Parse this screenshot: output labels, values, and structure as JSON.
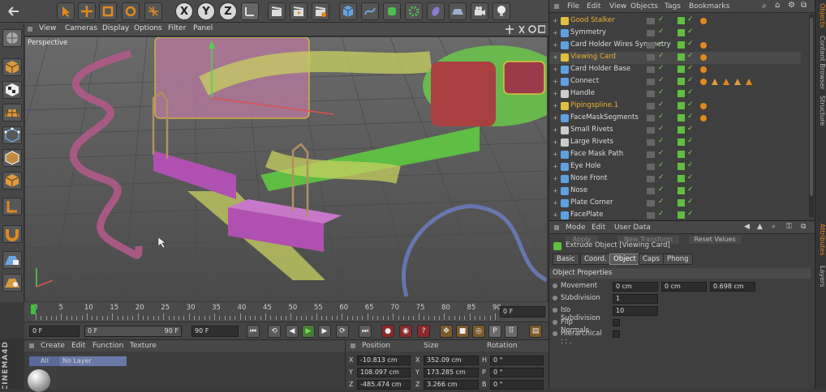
{
  "viewport": {
    "menu": [
      "View",
      "Cameras",
      "Display",
      "Options",
      "Filter",
      "Panel"
    ],
    "camera_label": "Perspective"
  },
  "timeline": {
    "ticks": [
      "0",
      "5",
      "10",
      "15",
      "20",
      "25",
      "30",
      "35",
      "40",
      "45",
      "50",
      "55",
      "60",
      "65",
      "70",
      "75",
      "80",
      "85",
      "90"
    ],
    "current_frame": "0 F",
    "start_field": "0 F",
    "range_start": "0 F",
    "range_end": "90 F",
    "end_field": "90 F"
  },
  "material_manager": {
    "menu": [
      "Create",
      "Edit",
      "Function",
      "Texture"
    ],
    "filters": [
      "All",
      "No Layer"
    ]
  },
  "coord_manager": {
    "headers": [
      "Position",
      "Size",
      "Rotation"
    ],
    "rows": [
      {
        "axis": "X",
        "pos": "-10.813 cm",
        "size_axis": "X",
        "size": "352.09 cm",
        "rot_axis": "H",
        "rot": "0 °"
      },
      {
        "axis": "Y",
        "pos": "108.097 cm",
        "size_axis": "Y",
        "size": "173.285 cm",
        "rot_axis": "P",
        "rot": "0 °"
      },
      {
        "axis": "Z",
        "pos": "-485.474 cm",
        "size_axis": "Z",
        "size": "3.266 cm",
        "rot_axis": "B",
        "rot": "0 °"
      }
    ]
  },
  "object_manager": {
    "menu": [
      "File",
      "Edit",
      "View",
      "Objects",
      "Tags",
      "Bookmarks"
    ],
    "objects": [
      {
        "name": "Good Stalker",
        "color": "#e0c040",
        "tags": 1
      },
      {
        "name": "Symmetry",
        "color": "#5fa0e0",
        "tags": 0
      },
      {
        "name": "Card Holder Wires Symmetry",
        "color": "#5fa0e0",
        "tags": 1
      },
      {
        "name": "Viewing Card",
        "color": "#e0c040",
        "tags": 1
      },
      {
        "name": "Card Holder Base",
        "color": "#5fa0e0",
        "tags": 1
      },
      {
        "name": "Connect",
        "color": "#5fa0e0",
        "tags": 5
      },
      {
        "name": "Handle",
        "color": "#cccccc",
        "tags": 0
      },
      {
        "name": "Pipingspline.1",
        "color": "#e0c040",
        "tags": 1
      },
      {
        "name": "FaceMaskSegments",
        "color": "#5fa0e0",
        "tags": 1
      },
      {
        "name": "Small Rivets",
        "color": "#cccccc",
        "tags": 0
      },
      {
        "name": "Large Rivets",
        "color": "#cccccc",
        "tags": 0
      },
      {
        "name": "Face Mask Path",
        "color": "#5fa0e0",
        "tags": 0
      },
      {
        "name": "Eye Hole",
        "color": "#5fa0e0",
        "tags": 0
      },
      {
        "name": "Nose Front",
        "color": "#5fa0e0",
        "tags": 0
      },
      {
        "name": "Nose",
        "color": "#5fa0e0",
        "tags": 0
      },
      {
        "name": "Plate Corner",
        "color": "#5fa0e0",
        "tags": 0
      },
      {
        "name": "FacePlate",
        "color": "#5fa0e0",
        "tags": 0
      }
    ]
  },
  "attribute_manager": {
    "menu": [
      "Mode",
      "Edit",
      "User Data"
    ],
    "buttons": [
      "Apply",
      "New Transform",
      "Reset Values"
    ],
    "object_title": "Extrude Object [Viewing Card]",
    "tabs": [
      "Basic",
      "Coord.",
      "Object",
      "Caps",
      "Phong"
    ],
    "active_tab": "Object",
    "section": "Object Properties",
    "movement_label": "Movement . . .",
    "movement": [
      "0 cm",
      "0 cm",
      "0.698 cm"
    ],
    "subdivision_label": "Subdivision . .",
    "subdivision": "1",
    "iso_label": "Iso Subdivision",
    "iso": "10",
    "flip_label": "Flip Normals . .",
    "hier_label": "Hierarchical . . ."
  },
  "side_tabs": [
    "Objects",
    "Content Browser",
    "Structure",
    "Attributes",
    "Layers"
  ],
  "branding": "CINEMA4D",
  "colors": {
    "accent": "#e08a1e",
    "active_green": "#5fbf3f",
    "frame_marker": "#40c040"
  }
}
